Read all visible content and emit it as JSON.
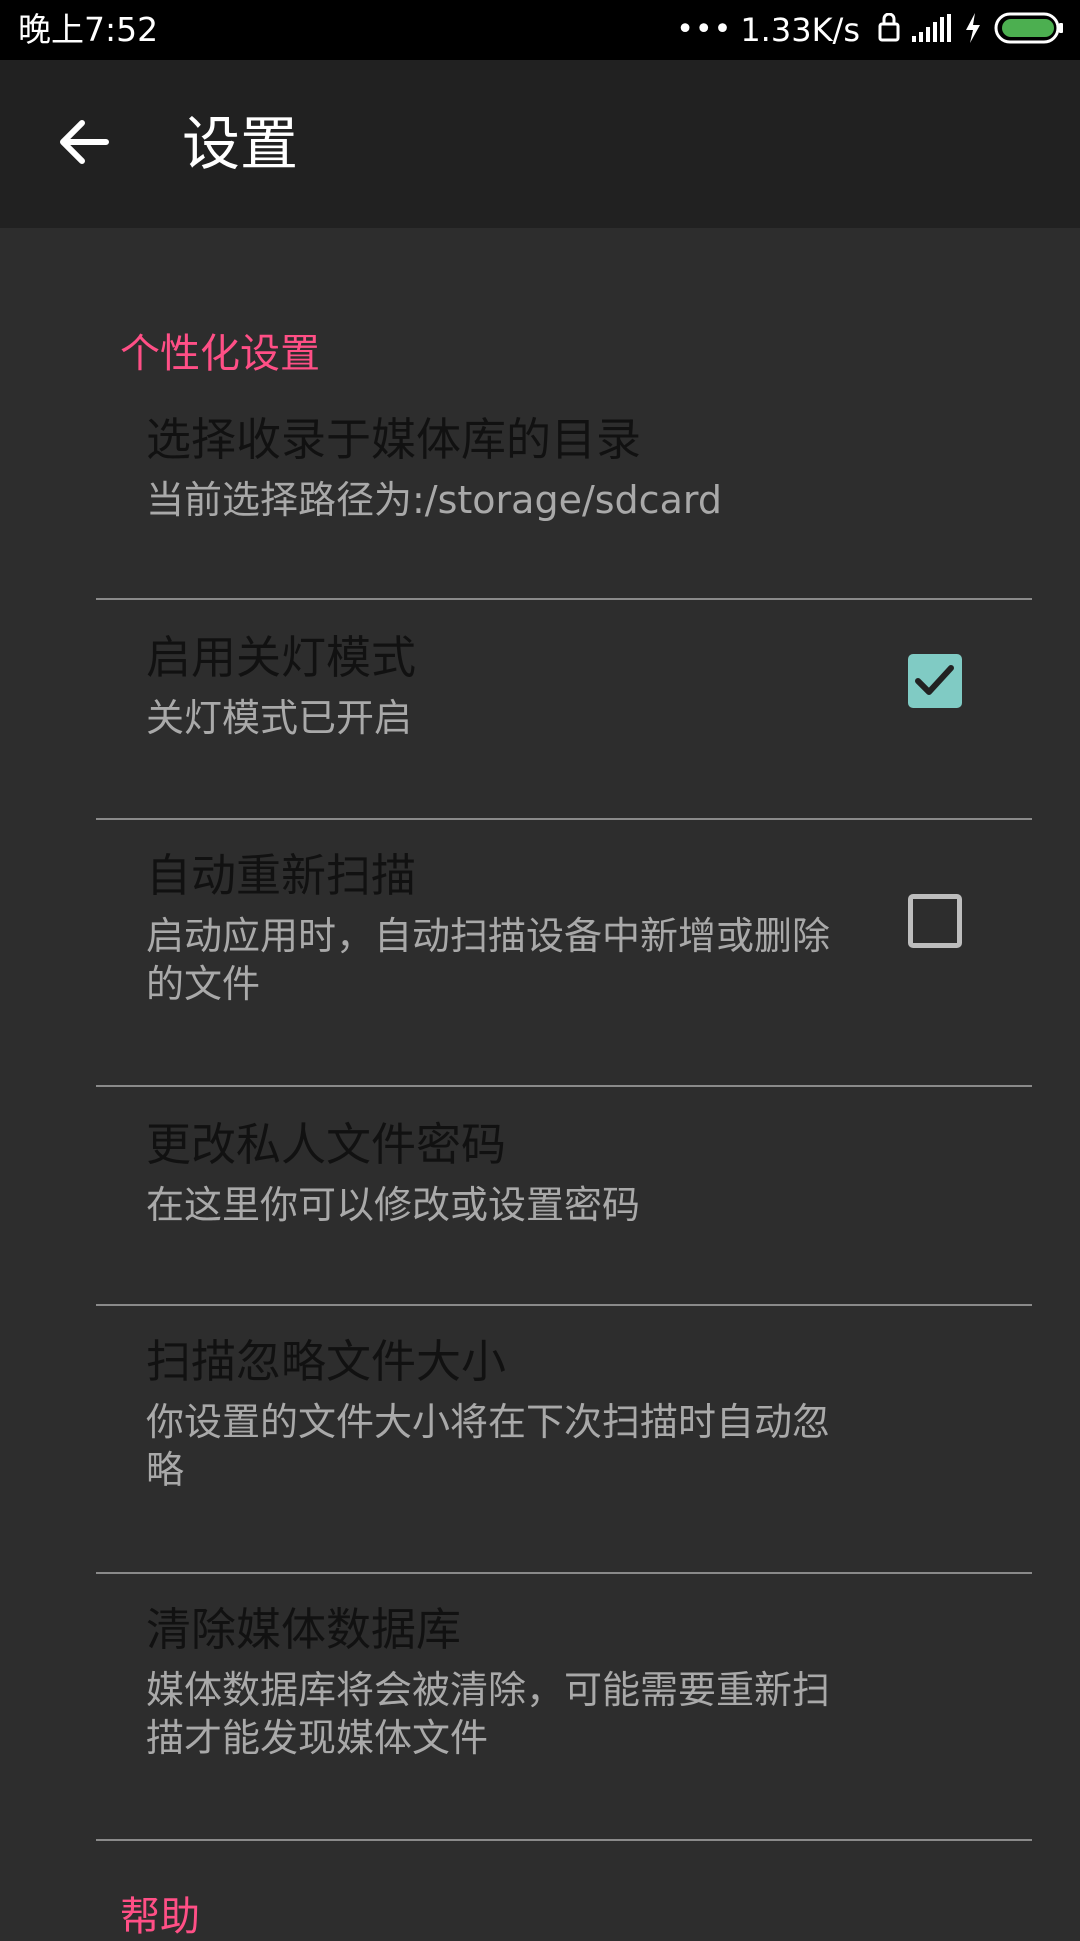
{
  "status_bar": {
    "time": "晚上7:52",
    "network_speed": "1.33K/s",
    "icons": [
      "more-dots-icon",
      "lock-icon",
      "signal-icon",
      "charging-icon",
      "battery-icon"
    ],
    "battery_color": "#4caf50"
  },
  "app_bar": {
    "title": "设置",
    "back_icon": "arrow-left-icon"
  },
  "sections": [
    {
      "header": "个性化设置",
      "items": [
        {
          "title": "选择收录于媒体库的目录",
          "summary": "当前选择路径为:/storage/sdcard"
        },
        {
          "title": "启用关灯模式",
          "summary": "关灯模式已开启",
          "checked": true
        },
        {
          "title": "自动重新扫描",
          "summary": "启动应用时，自动扫描设备中新增或删除的文件",
          "checked": false
        },
        {
          "title": "更改私人文件密码",
          "summary": "在这里你可以修改或设置密码"
        },
        {
          "title": "扫描忽略文件大小",
          "summary": "你设置的文件大小将在下次扫描时自动忽略"
        },
        {
          "title": "清除媒体数据库",
          "summary": "媒体数据库将会被清除，可能需要重新扫描才能发现媒体文件"
        }
      ]
    },
    {
      "header": "帮助",
      "items": []
    }
  ],
  "colors": {
    "accent": "#ff4f86",
    "checkbox_checked": "#80cbc4",
    "background": "#2d2d2d",
    "app_bar": "#212121"
  }
}
